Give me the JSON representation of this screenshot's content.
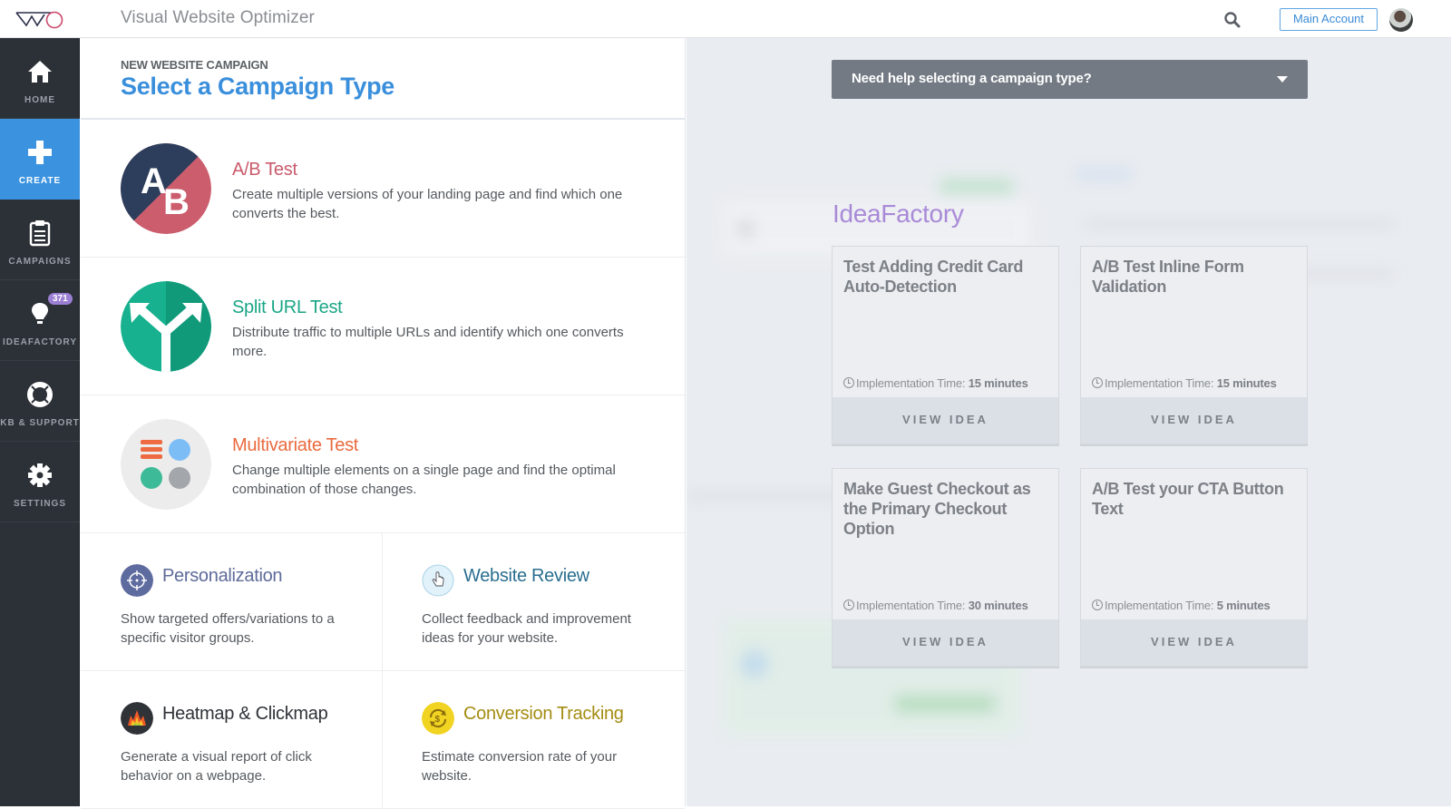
{
  "topbar": {
    "app_title": "Visual Website Optimizer",
    "logo": "vwo-logo",
    "search_icon": "search-icon",
    "account_label": "Main Account",
    "avatar": "user-avatar"
  },
  "sidebar": {
    "items": [
      {
        "label": "HOME",
        "icon": "home-icon",
        "active": false
      },
      {
        "label": "CREATE",
        "icon": "plus-icon",
        "active": true
      },
      {
        "label": "CAMPAIGNS",
        "icon": "clipboard-icon",
        "active": false
      },
      {
        "label": "IDEAFACTORY",
        "icon": "lightbulb-icon",
        "active": false,
        "badge": "371"
      },
      {
        "label": "KB & SUPPORT",
        "icon": "lifebuoy-icon",
        "active": false
      },
      {
        "label": "SETTINGS",
        "icon": "gear-icon",
        "active": false
      }
    ]
  },
  "panel": {
    "kicker": "NEW WEBSITE CAMPAIGN",
    "title": "Select a Campaign Type",
    "main_types": [
      {
        "title": "A/B Test",
        "desc": "Create multiple versions of your landing page and find which one converts the best.",
        "color": "#c95a6b",
        "icon": "ab-test-icon"
      },
      {
        "title": "Split URL Test",
        "desc": "Distribute traffic to multiple URLs and identify which one converts more.",
        "color": "#1aa687",
        "icon": "split-arrows-icon"
      },
      {
        "title": "Multivariate Test",
        "desc": "Change multiple elements on a single page and find the optimal combination of those changes.",
        "color": "#ea6a3f",
        "icon": "multivariate-icon"
      }
    ],
    "other_types": [
      {
        "title": "Personalization",
        "desc": "Show targeted offers/variations to a specific visitor groups.",
        "color": "#5e6b99",
        "icon": "crosshair-icon"
      },
      {
        "title": "Website Review",
        "desc": "Collect feedback and improvement ideas for your website.",
        "color": "#2a6f8f",
        "icon": "hand-pointer-icon"
      },
      {
        "title": "Heatmap & Clickmap",
        "desc": "Generate a visual report of click behavior on a webpage.",
        "color": "#2f3237",
        "icon": "flame-icon"
      },
      {
        "title": "Conversion Tracking",
        "desc": "Estimate conversion rate of your website.",
        "color": "#a48d12",
        "icon": "dollar-cycle-icon"
      }
    ]
  },
  "help": {
    "label": "Need help selecting a campaign type?"
  },
  "ideafactory": {
    "title": "IdeaFactory",
    "time_prefix": "Implementation Time:",
    "view_label": "VIEW IDEA",
    "ideas": [
      {
        "title": "Test Adding Credit Card Auto-Detection",
        "time": "15 minutes"
      },
      {
        "title": "A/B Test Inline Form Validation",
        "time": "15 minutes"
      },
      {
        "title": "Make Guest Checkout as the Primary Checkout Option",
        "time": "30 minutes"
      },
      {
        "title": "A/B Test your CTA Button Text",
        "time": "5 minutes"
      }
    ]
  }
}
